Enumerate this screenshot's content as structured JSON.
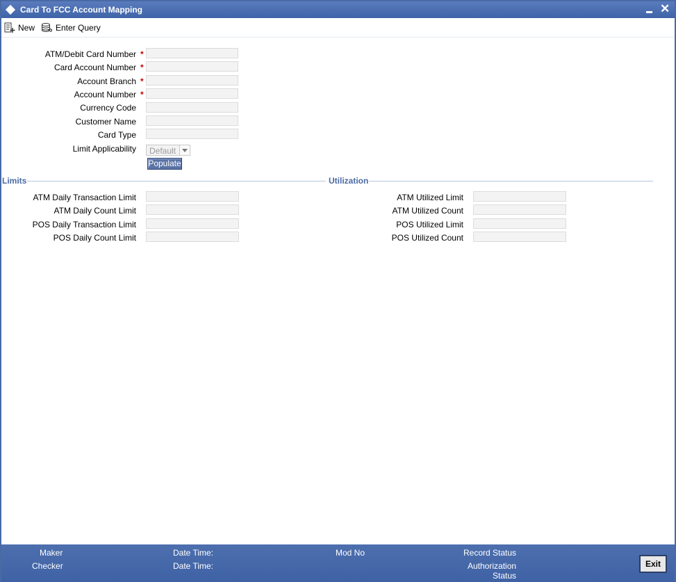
{
  "window": {
    "title": "Card To FCC Account Mapping"
  },
  "toolbar": {
    "new_label": "New",
    "enter_query_label": "Enter Query"
  },
  "form": {
    "atm_debit_card_number": "ATM/Debit Card Number",
    "card_account_number": "Card Account Number",
    "account_branch": "Account Branch",
    "account_number": "Account Number",
    "currency_code": "Currency Code",
    "customer_name": "Customer Name",
    "card_type": "Card Type",
    "limit_applicability": "Limit Applicability",
    "limit_applicability_value": "Default",
    "required_mark": "*",
    "populate_label": "Populate"
  },
  "limits": {
    "title": "Limits",
    "atm_daily_transaction_limit": "ATM Daily Transaction Limit",
    "atm_daily_count_limit": "ATM Daily Count Limit",
    "pos_daily_transaction_limit": "POS Daily Transaction Limit",
    "pos_daily_count_limit": "POS Daily Count Limit"
  },
  "utilization": {
    "title": "Utilization",
    "atm_utilized_limit": "ATM Utilized Limit",
    "atm_utilized_count": "ATM Utilized Count",
    "pos_utilized_limit": "POS Utilized Limit",
    "pos_utilized_count": "POS Utilized Count"
  },
  "footer": {
    "maker": "Maker",
    "checker": "Checker",
    "date_time_1": "Date Time:",
    "date_time_2": "Date Time:",
    "mod_no": "Mod No",
    "record_status": "Record Status",
    "authorization": "Authorization",
    "status": "Status",
    "exit_label": "Exit"
  }
}
